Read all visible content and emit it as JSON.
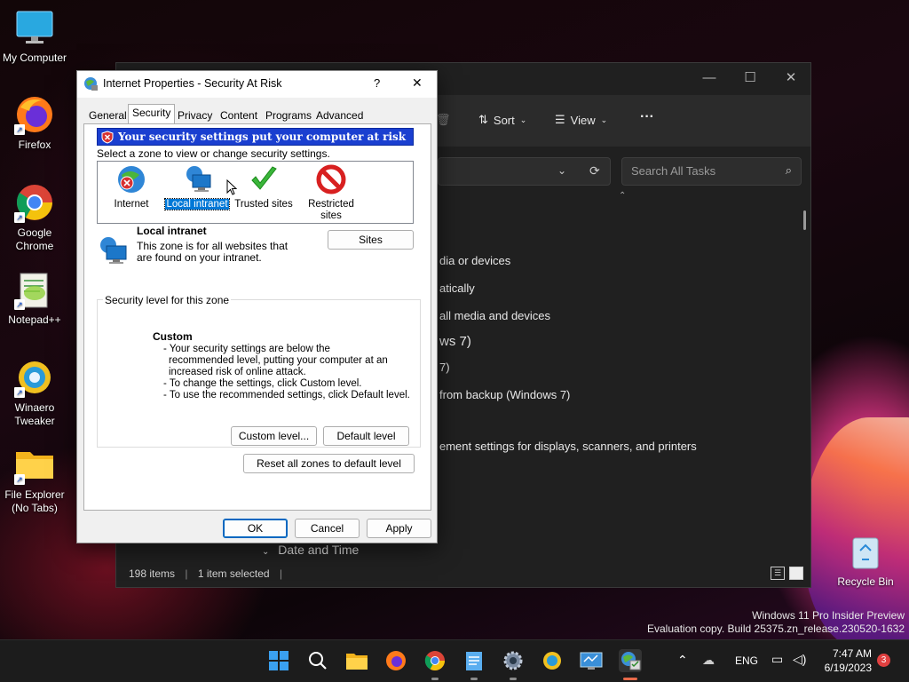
{
  "desktop": {
    "icons": [
      {
        "label": "My Computer"
      },
      {
        "label": "Firefox"
      },
      {
        "label": "Google Chrome"
      },
      {
        "label": "Notepad++"
      },
      {
        "label": "Winaero Tweaker"
      },
      {
        "label": "File Explorer (No Tabs)"
      },
      {
        "label": "Recycle Bin"
      }
    ],
    "watermark_line1": "Windows 11 Pro Insider Preview",
    "watermark_line2": "Evaluation copy. Build 25375.zn_release.230520-1632"
  },
  "explorer": {
    "toolbar": {
      "sort_label": "Sort",
      "view_label": "View",
      "more_label": "···"
    },
    "search_placeholder": "Search All Tasks",
    "items": [
      "dia or devices",
      "atically",
      "all media and devices",
      "ws 7)",
      "7)",
      "from backup (Windows 7)",
      "ement settings for displays, scanners, and printers"
    ],
    "group_header": "Date and Time",
    "status": {
      "count": "198 items",
      "selected": "1 item selected"
    }
  },
  "dialog": {
    "title": "Internet Properties - Security At Risk",
    "help_label": "?",
    "close_label": "✕",
    "tabs": [
      "General",
      "Security",
      "Privacy",
      "Content",
      "Programs",
      "Advanced"
    ],
    "active_tab": "Security",
    "warning_banner": "Your security settings put your computer at risk",
    "zone_prompt": "Select a zone to view or change security settings.",
    "zones": [
      {
        "label": "Internet"
      },
      {
        "label": "Local intranet"
      },
      {
        "label": "Trusted sites"
      },
      {
        "label": "Restricted sites"
      }
    ],
    "selected_zone": {
      "name": "Local intranet",
      "description": "This zone is for all websites that are found on your intranet.",
      "sites_button": "Sites"
    },
    "security_level": {
      "group_label": "Security level for this zone",
      "level_name": "Custom",
      "bullet1": "- Your security settings are below the recommended level, putting your computer at an increased risk of online attack.",
      "bullet2": "- To change the settings, click Custom level.",
      "bullet3": "- To use the recommended settings, click Default level.",
      "custom_button": "Custom level...",
      "default_button": "Default level"
    },
    "reset_button": "Reset all zones to default level",
    "ok_button": "OK",
    "cancel_button": "Cancel",
    "apply_button": "Apply"
  },
  "taskbar": {
    "language": "ENG",
    "time": "7:47 AM",
    "date": "6/19/2023",
    "notification_count": "3"
  }
}
